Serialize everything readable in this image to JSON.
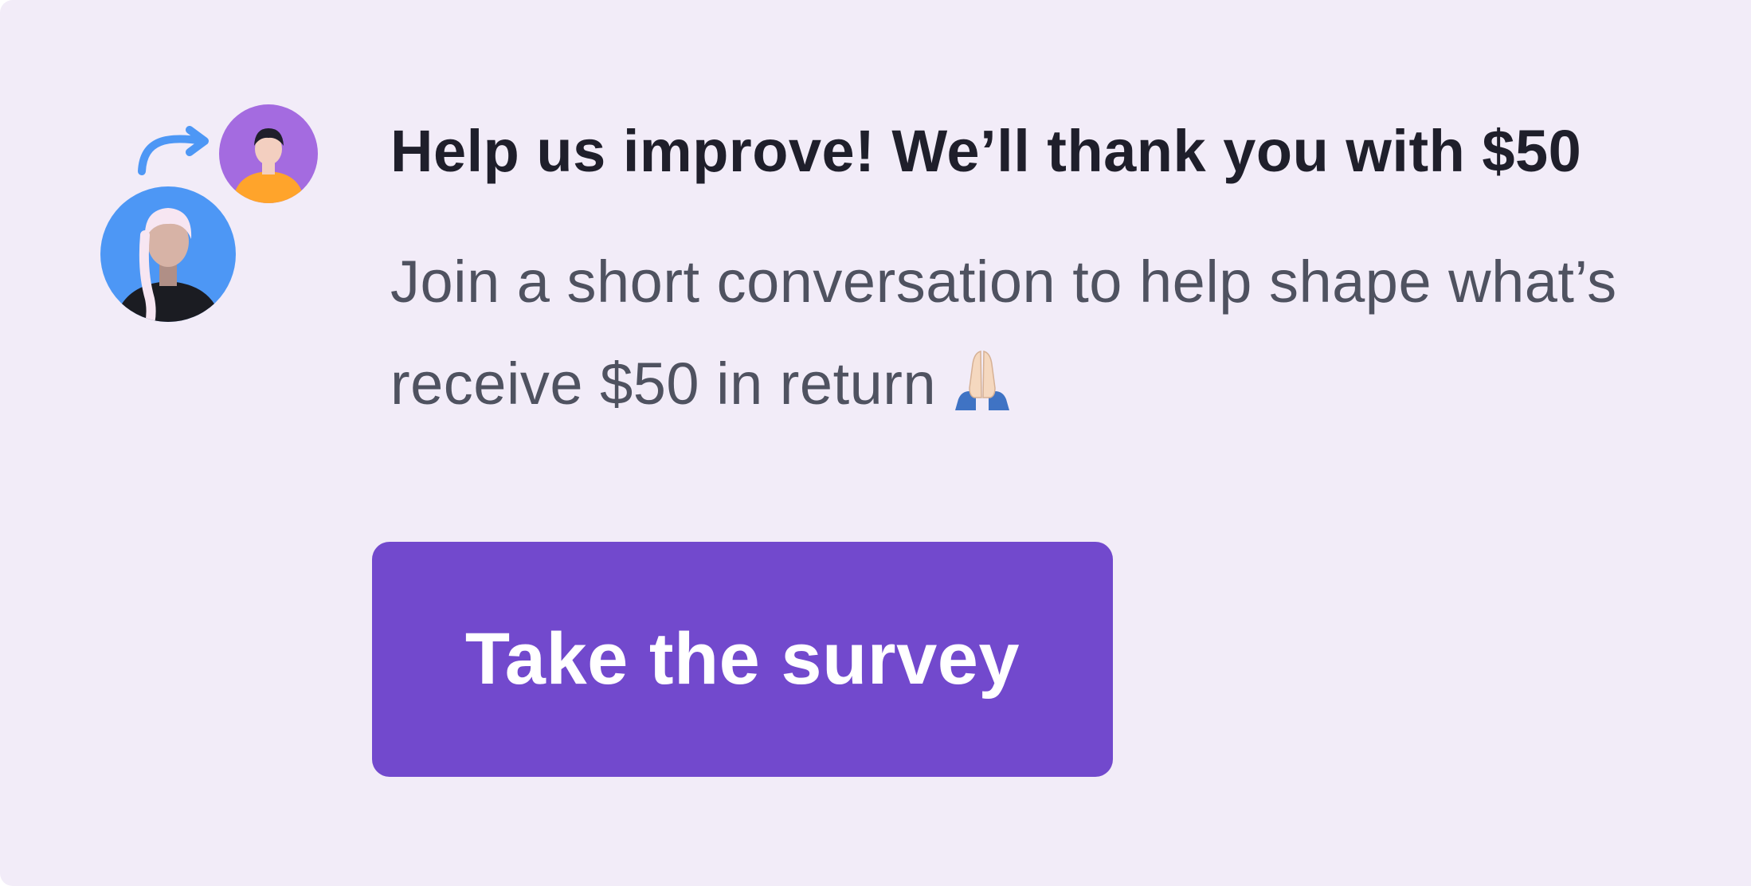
{
  "banner": {
    "title": "Help us improve! We’ll thank you with $50",
    "body_line_1": "Join a short conversation to help shape what’s",
    "body_line_2": "receive $50 in return",
    "emoji": "folded-hands-icon",
    "cta_label": "Take the survey"
  },
  "icons": {
    "illustration": "people-exchange-illustration",
    "arrow": "curved-arrow-icon",
    "avatar_small": "man-avatar",
    "avatar_large": "woman-avatar"
  },
  "colors": {
    "card_background": "#f2ecf8",
    "button": "#7249cd",
    "button_text": "#ffffff",
    "title_text": "#1f1f2b",
    "body_text": "#4f5260",
    "avatar_small_bg": "#a46be0",
    "avatar_large_bg": "#4d97f5",
    "arrow": "#4d97f5"
  }
}
